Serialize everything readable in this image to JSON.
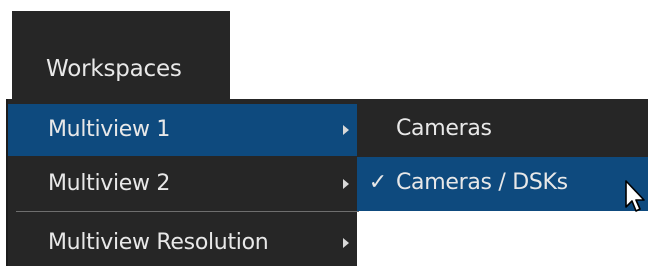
{
  "header": {
    "title": "Workspaces"
  },
  "menu": {
    "items": [
      {
        "label": "Multiview 1",
        "has_submenu": true,
        "highlighted": true
      },
      {
        "label": "Multiview 2",
        "has_submenu": true,
        "highlighted": false
      },
      {
        "label": "Multiview Resolution",
        "has_submenu": true,
        "highlighted": false
      }
    ]
  },
  "submenu": {
    "items": [
      {
        "label": "Cameras",
        "checked": false,
        "highlighted": false
      },
      {
        "label": "Cameras / DSKs",
        "checked": true,
        "check_glyph": "✓",
        "highlighted": true
      }
    ]
  },
  "icons": {
    "submenu_arrow": "chevron-right-icon",
    "cursor": "mouse-pointer-icon"
  },
  "colors": {
    "menu_bg": "#262626",
    "highlight": "#0e4a7e",
    "text": "#e8e8e8"
  }
}
